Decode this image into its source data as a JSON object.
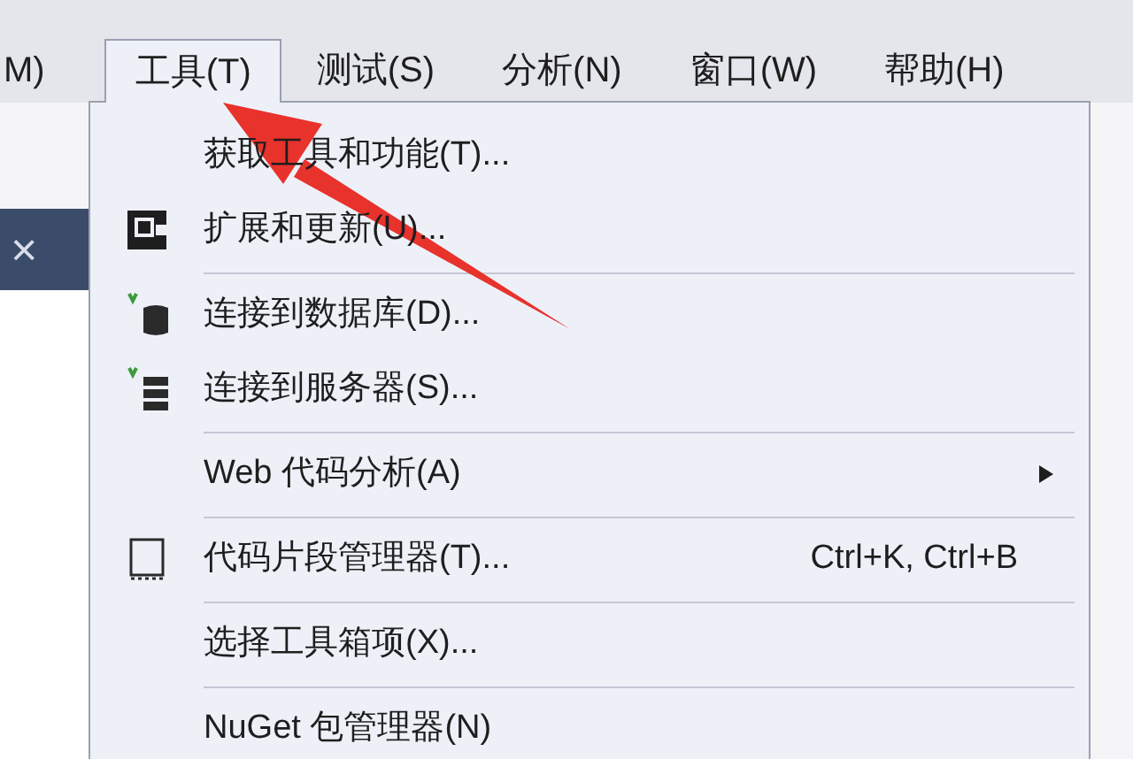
{
  "menu_bar": {
    "items": [
      {
        "label": "M)",
        "selected": false
      },
      {
        "label": "工具(T)",
        "selected": true
      },
      {
        "label": "测试(S)",
        "selected": false
      },
      {
        "label": "分析(N)",
        "selected": false
      },
      {
        "label": "窗口(W)",
        "selected": false
      },
      {
        "label": "帮助(H)",
        "selected": false
      }
    ]
  },
  "document_tab": {
    "close": "×"
  },
  "menu": {
    "items": [
      {
        "kind": "item",
        "label": "获取工具和功能(T)..."
      },
      {
        "kind": "item",
        "label": "扩展和更新(U)..."
      },
      {
        "kind": "separator"
      },
      {
        "kind": "item",
        "label": "连接到数据库(D)..."
      },
      {
        "kind": "item",
        "label": "连接到服务器(S)..."
      },
      {
        "kind": "separator"
      },
      {
        "kind": "item",
        "label": "Web 代码分析(A)",
        "submenu": true
      },
      {
        "kind": "separator"
      },
      {
        "kind": "item",
        "label": "代码片段管理器(T)...",
        "shortcut": "Ctrl+K, Ctrl+B"
      },
      {
        "kind": "separator"
      },
      {
        "kind": "item",
        "label": "选择工具箱项(X)..."
      },
      {
        "kind": "separator"
      },
      {
        "kind": "item",
        "label": "NuGet 包管理器(N)"
      }
    ]
  }
}
